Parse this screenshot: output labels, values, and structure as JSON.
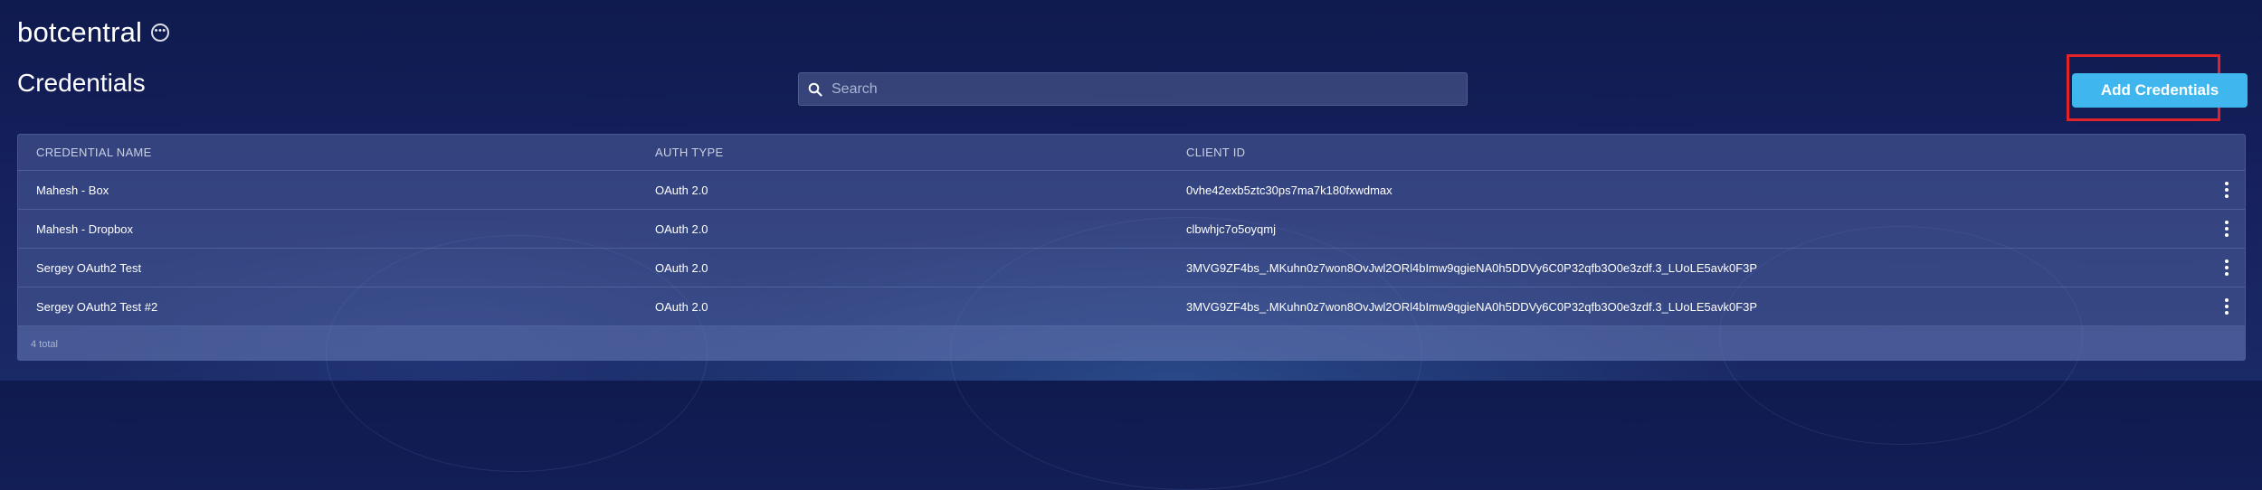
{
  "app": {
    "name": "botcentral",
    "more_icon": "more-horizontal-circle-icon"
  },
  "page": {
    "title": "Credentials"
  },
  "search": {
    "placeholder": "Search",
    "value": "",
    "icon": "search-icon"
  },
  "actions": {
    "add_label": "Add Credentials",
    "add_color": "#3fb6ee",
    "highlight_color": "#e0242a"
  },
  "table": {
    "headers": {
      "name": "CREDENTIAL NAME",
      "auth": "AUTH TYPE",
      "client": "CLIENT ID"
    },
    "rows": [
      {
        "name": "Mahesh - Box",
        "auth": "OAuth 2.0",
        "client": "0vhe42exb5ztc30ps7ma7k180fxwdmax",
        "menu_icon": "kebab-menu-icon"
      },
      {
        "name": "Mahesh - Dropbox",
        "auth": "OAuth 2.0",
        "client": "clbwhjc7o5oyqmj",
        "menu_icon": "kebab-menu-icon"
      },
      {
        "name": "Sergey OAuth2 Test",
        "auth": "OAuth 2.0",
        "client": "3MVG9ZF4bs_.MKuhn0z7won8OvJwl2ORl4bImw9qgieNA0h5DDVy6C0P32qfb3O0e3zdf.3_LUoLE5avk0F3P",
        "menu_icon": "kebab-menu-icon"
      },
      {
        "name": "Sergey OAuth2 Test #2",
        "auth": "OAuth 2.0",
        "client": "3MVG9ZF4bs_.MKuhn0z7won8OvJwl2ORl4bImw9qgieNA0h5DDVy6C0P32qfb3O0e3zdf.3_LUoLE5avk0F3P",
        "menu_icon": "kebab-menu-icon"
      }
    ],
    "footer": "4 total"
  }
}
